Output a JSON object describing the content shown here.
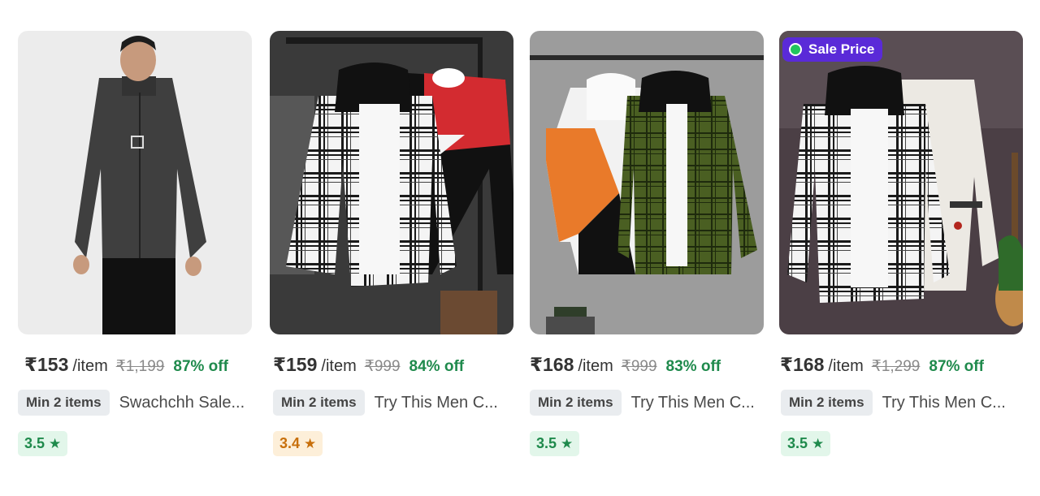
{
  "products": [
    {
      "price": "₹153",
      "per": "/item",
      "mrp": "₹1,199",
      "discount": "87% off",
      "min_items": "Min 2 items",
      "title": "Swachchh Sale...",
      "rating": "3.5",
      "rating_color": "#1f8a4c"
    },
    {
      "price": "₹159",
      "per": "/item",
      "mrp": "₹999",
      "discount": "84% off",
      "min_items": "Min 2 items",
      "title": "Try This Men C...",
      "rating": "3.4",
      "rating_color": "#c8700c"
    },
    {
      "price": "₹168",
      "per": "/item",
      "mrp": "₹999",
      "discount": "83% off",
      "min_items": "Min 2 items",
      "title": "Try This Men C...",
      "rating": "3.5",
      "rating_color": "#1f8a4c"
    },
    {
      "price": "₹168",
      "per": "/item",
      "mrp": "₹1,299",
      "discount": "87% off",
      "min_items": "Min 2 items",
      "title": "Try This Men C...",
      "rating": "3.5",
      "rating_color": "#1f8a4c",
      "badge": "Sale Price"
    }
  ],
  "icons": {
    "rating": "star-icon",
    "sale": "green-dot-icon"
  }
}
